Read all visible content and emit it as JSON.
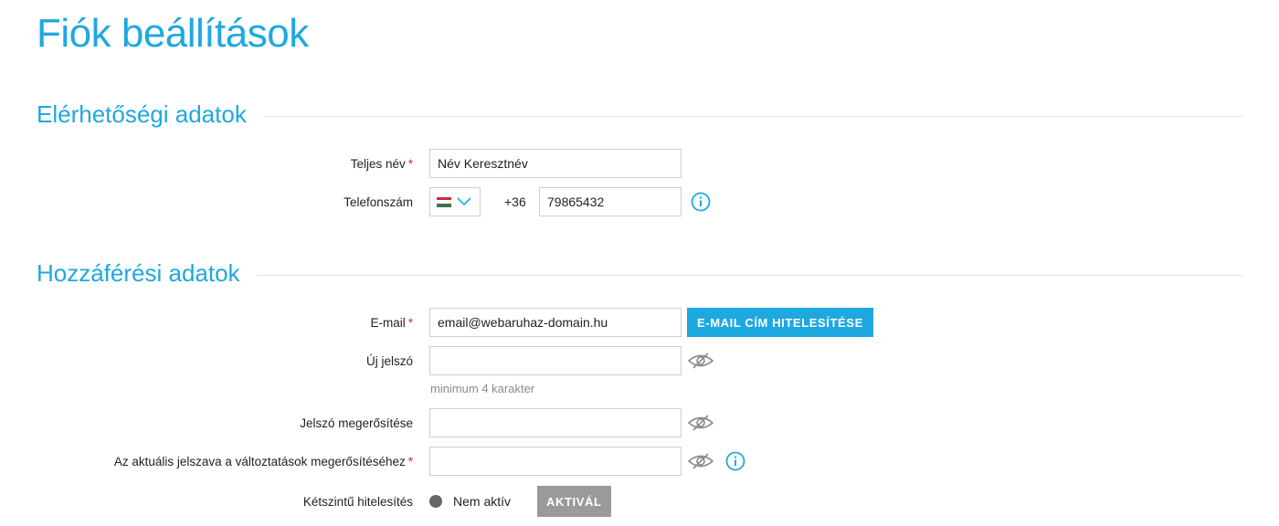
{
  "page": {
    "title": "Fiók beállítások"
  },
  "contact": {
    "heading": "Elérhetőségi adatok",
    "full_name": {
      "label": "Teljes név",
      "required": "*",
      "value": "Név Keresztnév"
    },
    "phone": {
      "label": "Telefonszám",
      "country": "HU",
      "prefix": "+36",
      "value": "79865432"
    }
  },
  "access": {
    "heading": "Hozzáférési adatok",
    "email": {
      "label": "E-mail",
      "required": "*",
      "value": "email@webaruhaz-domain.hu",
      "verify_button": "E-MAIL CÍM HITELESÍTÉSE"
    },
    "new_password": {
      "label": "Új jelszó",
      "value": "",
      "hint": "minimum 4 karakter"
    },
    "confirm_password": {
      "label": "Jelszó megerősítése",
      "value": ""
    },
    "current_password": {
      "label": "Az aktuális jelszava a változtatások megerősítéséhez",
      "required": "*",
      "value": ""
    },
    "two_factor": {
      "label": "Kétszintű hitelesítés",
      "status": "Nem aktív",
      "activate_button": "AKTIVÁL"
    }
  },
  "colors": {
    "accent": "#1ea8e0",
    "required": "#e0262f",
    "status_inactive": "#666666",
    "button_disabled": "#9a9a9a"
  },
  "icons": [
    "info-icon",
    "eye-slash-icon",
    "chevron-down-icon",
    "hungary-flag-icon"
  ]
}
